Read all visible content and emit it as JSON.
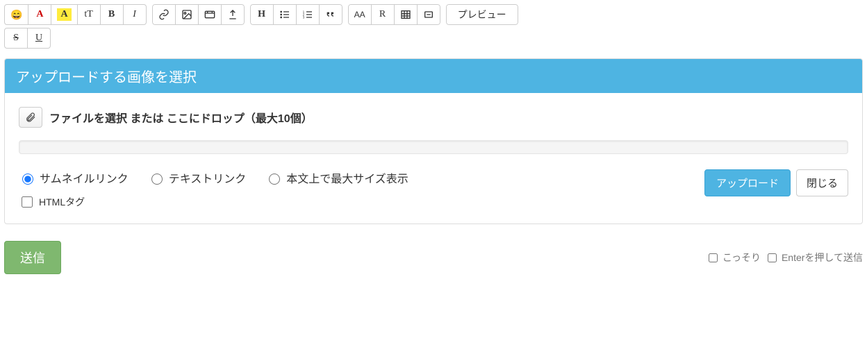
{
  "toolbar": {
    "emoji": "😄",
    "font_color": "A",
    "bg_color": "A",
    "text_size": "tT",
    "bold": "B",
    "italic": "I",
    "strike": "S",
    "underline": "U",
    "heading": "H",
    "aa": "AA",
    "r": "R",
    "preview": "プレビュー"
  },
  "panel": {
    "title": "アップロードする画像を選択",
    "file_label": "ファイルを選択 または ここにドロップ（最大10個）",
    "radio_thumb": "サムネイルリンク",
    "radio_text": "テキストリンク",
    "radio_max": "本文上で最大サイズ表示",
    "check_html": "HTMLタグ",
    "upload_btn": "アップロード",
    "close_btn": "閉じる"
  },
  "footer": {
    "submit": "送信",
    "secret": "こっそり",
    "enter_send": "Enterを押して送信"
  }
}
